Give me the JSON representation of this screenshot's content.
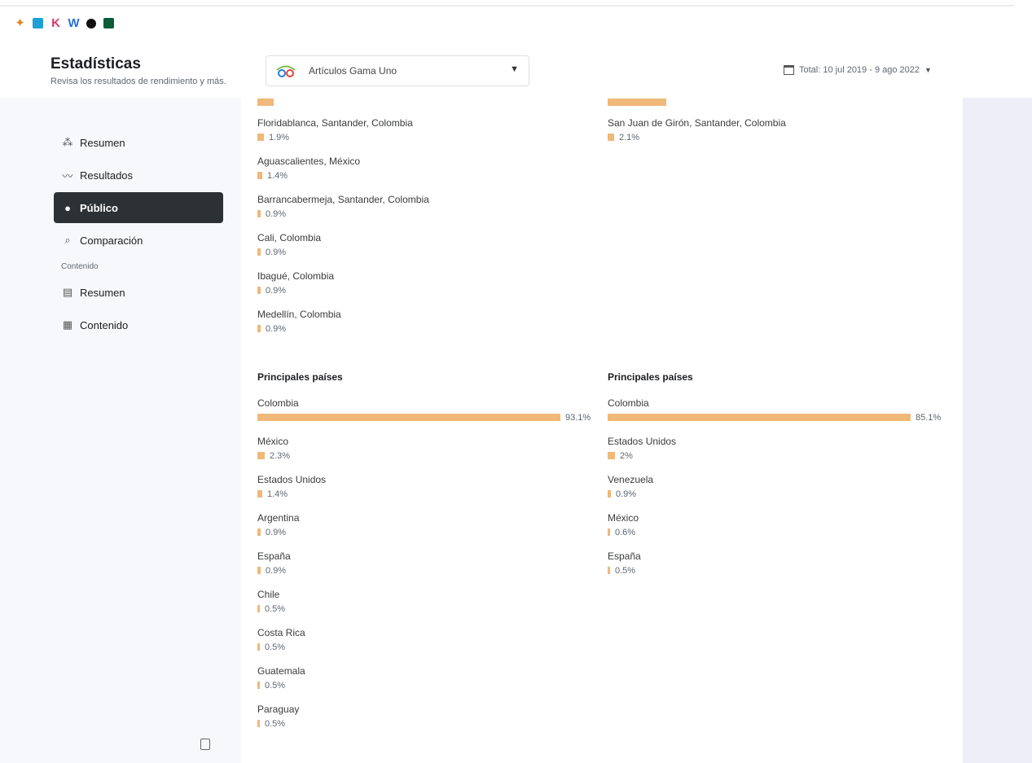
{
  "app_icons": [
    "pinwheel-icon",
    "square-app-icon",
    "k-logo-icon",
    "w-logo-icon",
    "circle-app-icon",
    "green-app-icon"
  ],
  "header": {
    "title": "Estadísticas",
    "subtitle": "Revisa los resultados de rendimiento y más.",
    "account": "Artículos Gama Uno",
    "date_range": "Total: 10 jul 2019 - 9 ago 2022"
  },
  "sidebar": {
    "items": [
      {
        "label": "Resumen",
        "icon": "network-icon",
        "active": false
      },
      {
        "label": "Resultados",
        "icon": "trend-icon",
        "active": false
      },
      {
        "label": "Público",
        "icon": "people-icon",
        "active": true
      },
      {
        "label": "Comparación",
        "icon": "compare-icon",
        "active": false
      }
    ],
    "section_label": "Contenido",
    "content_items": [
      {
        "label": "Resumen",
        "icon": "content-summary-icon"
      },
      {
        "label": "Contenido",
        "icon": "table-icon"
      }
    ]
  },
  "colors": {
    "bar": "#f0b879",
    "active_nav": "#2c3136"
  },
  "cities_left": [
    {
      "name": "Floridablanca, Santander, Colombia",
      "pct": 1.9,
      "label": "1.9%"
    },
    {
      "name": "Aguascalientes, México",
      "pct": 1.4,
      "label": "1.4%"
    },
    {
      "name": "Barrancabermeja, Santander, Colombia",
      "pct": 0.9,
      "label": "0.9%"
    },
    {
      "name": "Cali, Colombia",
      "pct": 0.9,
      "label": "0.9%"
    },
    {
      "name": "Ibagué, Colombia",
      "pct": 0.9,
      "label": "0.9%"
    },
    {
      "name": "Medellín, Colombia",
      "pct": 0.9,
      "label": "0.9%"
    }
  ],
  "cities_right": [
    {
      "name": "San Juan de Girón, Santander, Colombia",
      "pct": 2.1,
      "label": "2.1%"
    }
  ],
  "countries_left": {
    "title": "Principales países",
    "items": [
      {
        "name": "Colombia",
        "pct": 93.1,
        "label": "93.1%"
      },
      {
        "name": "México",
        "pct": 2.3,
        "label": "2.3%"
      },
      {
        "name": "Estados Unidos",
        "pct": 1.4,
        "label": "1.4%"
      },
      {
        "name": "Argentina",
        "pct": 0.9,
        "label": "0.9%"
      },
      {
        "name": "España",
        "pct": 0.9,
        "label": "0.9%"
      },
      {
        "name": "Chile",
        "pct": 0.5,
        "label": "0.5%"
      },
      {
        "name": "Costa Rica",
        "pct": 0.5,
        "label": "0.5%"
      },
      {
        "name": "Guatemala",
        "pct": 0.5,
        "label": "0.5%"
      },
      {
        "name": "Paraguay",
        "pct": 0.5,
        "label": "0.5%"
      }
    ]
  },
  "countries_right": {
    "title": "Principales países",
    "items": [
      {
        "name": "Colombia",
        "pct": 85.1,
        "label": "85.1%"
      },
      {
        "name": "Estados Unidos",
        "pct": 2.0,
        "label": "2%"
      },
      {
        "name": "Venezuela",
        "pct": 0.9,
        "label": "0.9%"
      },
      {
        "name": "México",
        "pct": 0.6,
        "label": "0.6%"
      },
      {
        "name": "España",
        "pct": 0.5,
        "label": "0.5%"
      }
    ]
  }
}
